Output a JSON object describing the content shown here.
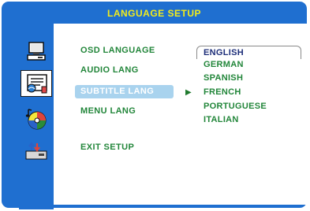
{
  "header": {
    "title": "LANGUAGE SETUP"
  },
  "sidebar": {
    "icons": [
      "computer-icon",
      "language-settings-icon",
      "audio-disc-icon",
      "preferences-icon"
    ]
  },
  "menu": {
    "items": [
      "OSD LANGUAGE",
      "AUDIO LANG",
      "SUBTITLE LANG",
      "MENU LANG",
      "EXIT SETUP"
    ],
    "selected": "SUBTITLE LANG"
  },
  "options": {
    "items": [
      "ENGLISH",
      "GERMAN",
      "SPANISH",
      "FRENCH",
      "PORTUGUESE",
      "ITALIAN"
    ],
    "current": "ENGLISH"
  },
  "colors": {
    "frame": "#1f6fd0",
    "title_text": "#f4ec1a",
    "menu_text": "#22863a",
    "highlight": "#a9d3ee",
    "current_option_text": "#1e2f7a"
  }
}
